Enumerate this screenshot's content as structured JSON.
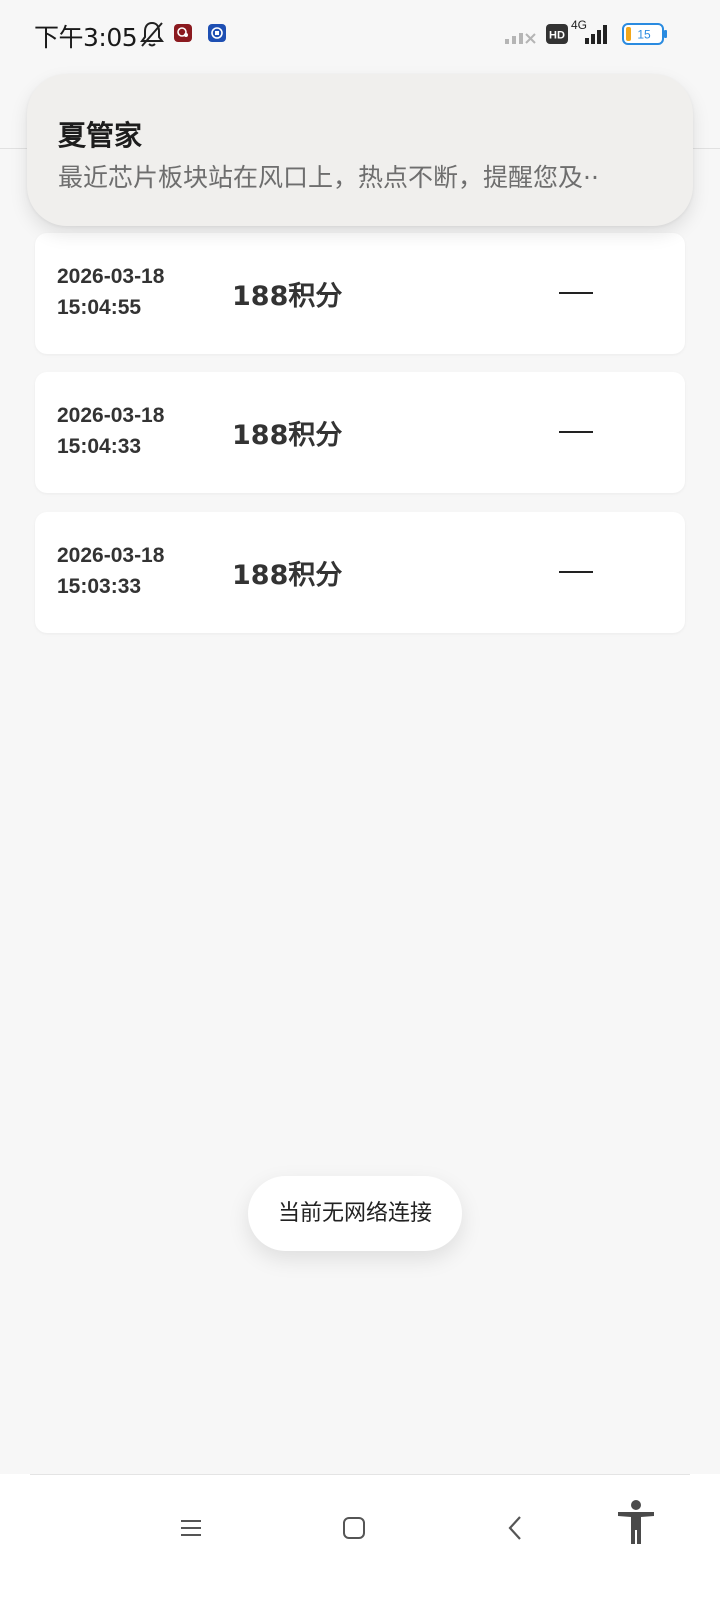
{
  "status_bar": {
    "time": "下午3:05",
    "network_type": "4G",
    "hd_label": "HD",
    "battery_level": "15"
  },
  "notification": {
    "title": "夏管家",
    "body": "最近芯片板块站在风口上，热点不断，提醒您及··"
  },
  "records": [
    {
      "date": "2026-03-18\n15:04:55",
      "points": "188积分",
      "status": "—"
    },
    {
      "date": "2026-03-18\n15:04:33",
      "points": "188积分",
      "status": "—"
    },
    {
      "date": "2026-03-18\n15:03:33",
      "points": "188积分",
      "status": "—"
    }
  ],
  "toast": {
    "text": "当前无网络连接"
  },
  "nav": {
    "icons": [
      "menu-icon",
      "home-square-icon",
      "back-chevron-icon",
      "accessibility-icon"
    ]
  }
}
